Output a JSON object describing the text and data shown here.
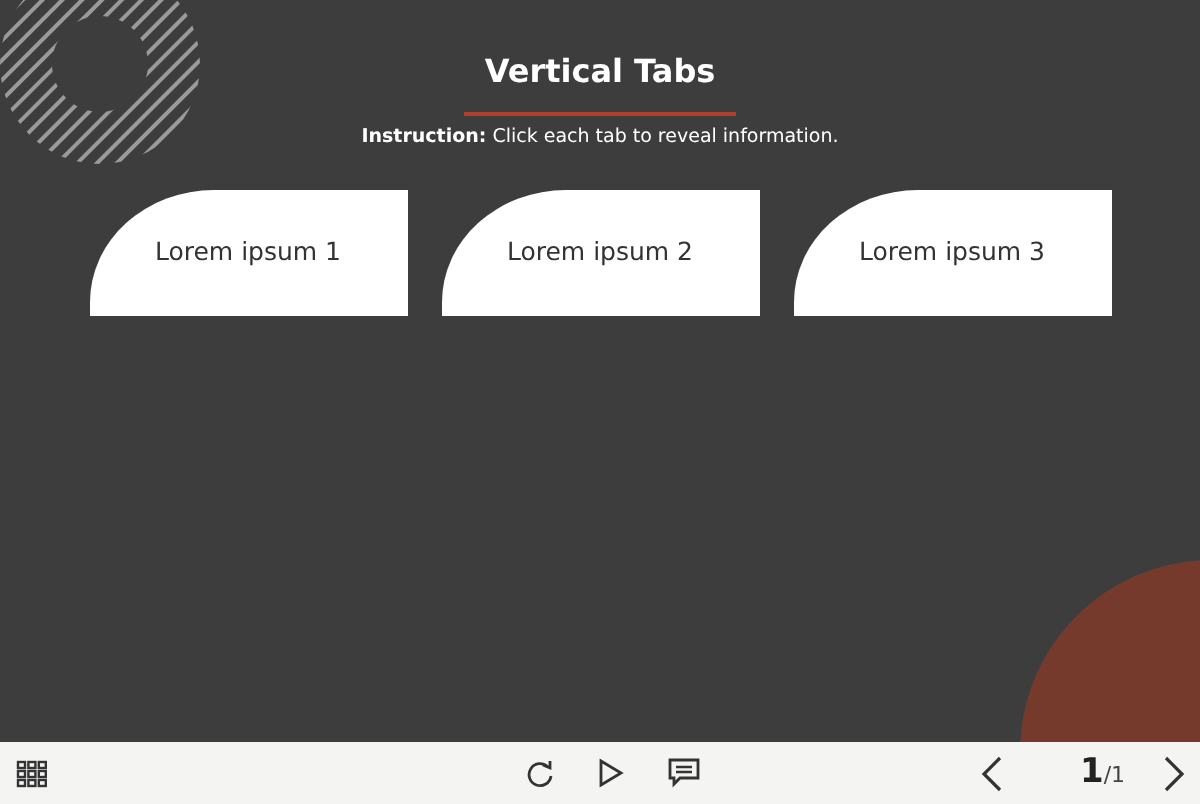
{
  "title": "Vertical Tabs",
  "instruction": "**Instruction:** Click each tab to reveal information.",
  "tabs": [
    {
      "label": "Lorem ipsum 1"
    },
    {
      "label": "Lorem ipsum 2"
    },
    {
      "label": "Lorem ipsum 3"
    }
  ],
  "player": {
    "page_current": "1",
    "page_total": "/1"
  }
}
